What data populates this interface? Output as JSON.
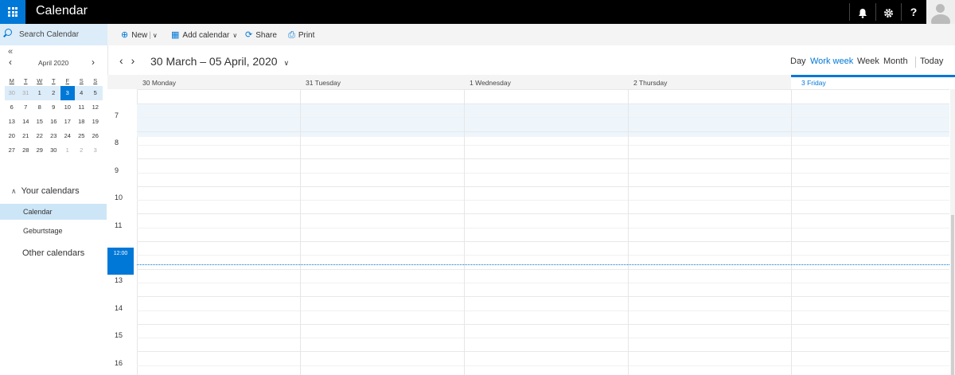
{
  "app": {
    "title": "Calendar"
  },
  "topbar": {
    "icons": [
      "bell-icon",
      "gear-icon",
      "help-icon",
      "avatar-icon"
    ],
    "help_label": "?"
  },
  "search": {
    "placeholder": "Search Calendar"
  },
  "toolbar": {
    "new_label": "New",
    "add_calendar_label": "Add calendar",
    "share_label": "Share",
    "print_label": "Print"
  },
  "mini_calendar": {
    "month_label": "April 2020",
    "weekday_initials": [
      "M",
      "T",
      "W",
      "T",
      "F",
      "S",
      "S"
    ],
    "weeks": [
      [
        "30",
        "31",
        "1",
        "2",
        "3",
        "4",
        "5"
      ],
      [
        "6",
        "7",
        "8",
        "9",
        "10",
        "11",
        "12"
      ],
      [
        "13",
        "14",
        "15",
        "16",
        "17",
        "18",
        "19"
      ],
      [
        "20",
        "21",
        "22",
        "23",
        "24",
        "25",
        "26"
      ],
      [
        "27",
        "28",
        "29",
        "30",
        "1",
        "2",
        "3"
      ]
    ],
    "today": "3"
  },
  "sidebar": {
    "your_calendars_label": "Your calendars",
    "calendars": [
      "Calendar",
      "Geburtstage"
    ],
    "other_calendars_label": "Other calendars"
  },
  "main": {
    "range_title": "30 March – 05 April, 2020",
    "views": [
      "Day",
      "Work week",
      "Week",
      "Month",
      "Today"
    ],
    "active_view": "Work week",
    "days": [
      "30 Monday",
      "31 Tuesday",
      "1 Wednesday",
      "2 Thursday",
      "3 Friday"
    ],
    "today_day": "3 Friday",
    "hours": [
      "7",
      "8",
      "9",
      "10",
      "11",
      "12:00",
      "13",
      "14",
      "15",
      "16"
    ],
    "current_time_label": "12:00"
  },
  "colors": {
    "accent": "#0078d7",
    "topbar": "#000000",
    "selection": "#cde6f7"
  }
}
